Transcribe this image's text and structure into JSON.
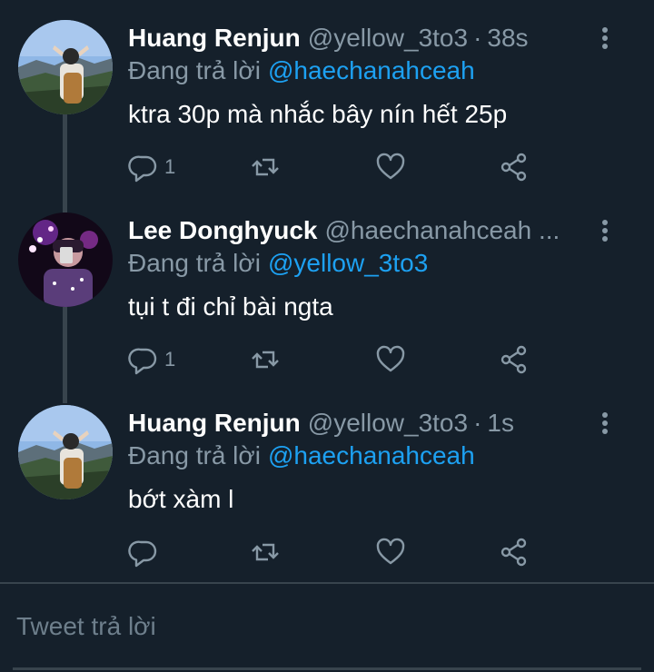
{
  "tweets": [
    {
      "display_name": "Huang Renjun",
      "handle": "@yellow_3to3",
      "time": "38s",
      "reply_prefix": "Đang trả lời",
      "reply_to": "@haechanahceah",
      "text": "ktra 30p mà nhắc bây nín hết 25p",
      "reply_count": "1",
      "avatar": "mountain-selfie-avatar"
    },
    {
      "display_name": "Lee Donghyuck",
      "handle": "@haechanahceah ...",
      "time": "",
      "reply_prefix": "Đang trả lời",
      "reply_to": "@yellow_3to3",
      "text": "tụi t đi chỉ bài ngta",
      "reply_count": "1",
      "avatar": "night-lights-avatar"
    },
    {
      "display_name": "Huang Renjun",
      "handle": "@yellow_3to3",
      "time": "1s",
      "reply_prefix": "Đang trả lời",
      "reply_to": "@haechanahceah",
      "text": "bớt xàm l",
      "reply_count": "",
      "avatar": "mountain-selfie-avatar"
    }
  ],
  "compose": {
    "placeholder": "Tweet trả lời"
  },
  "icons": {
    "reply": "reply-icon",
    "retweet": "retweet-icon",
    "like": "heart-icon",
    "share": "share-icon",
    "more": "more-vertical-icon"
  },
  "colors": {
    "background": "#15202b",
    "text": "#ffffff",
    "secondary": "#8899a6",
    "link": "#1da1f2",
    "divider": "#38444d"
  }
}
